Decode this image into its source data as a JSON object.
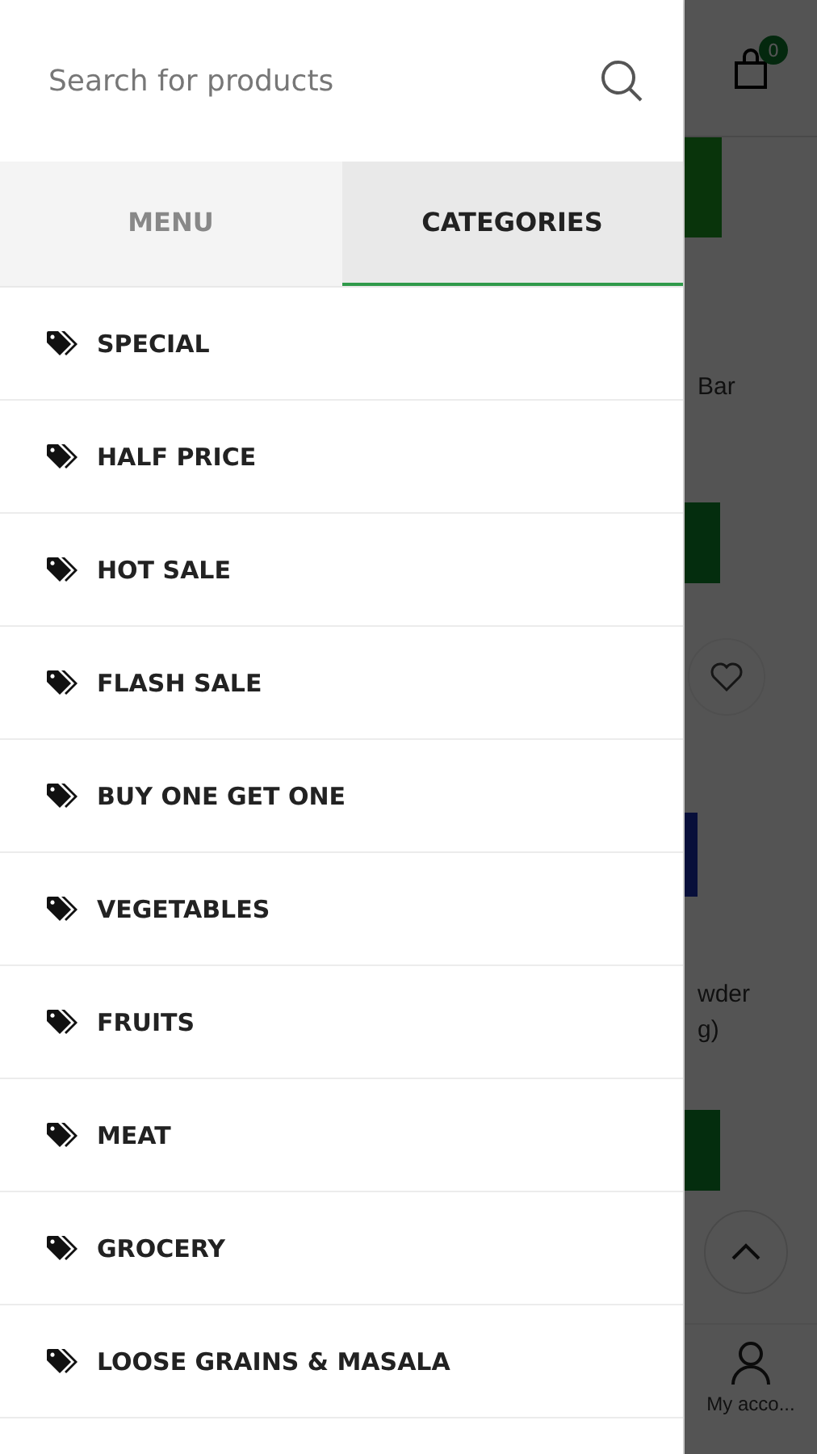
{
  "search": {
    "placeholder": "Search for products"
  },
  "tabs": [
    {
      "label": "MENU",
      "selected": false
    },
    {
      "label": "CATEGORIES",
      "selected": true
    }
  ],
  "categories": [
    {
      "label": "SPECIAL"
    },
    {
      "label": "HALF PRICE"
    },
    {
      "label": "HOT SALE"
    },
    {
      "label": "FLASH SALE"
    },
    {
      "label": "BUY ONE GET ONE"
    },
    {
      "label": "VEGETABLES"
    },
    {
      "label": "FRUITS"
    },
    {
      "label": "MEAT"
    },
    {
      "label": "GROCERY"
    },
    {
      "label": "LOOSE GRAINS & MASALA"
    }
  ],
  "background_page": {
    "cart_count": "0",
    "products": [
      {
        "title_lines": [
          "Bar"
        ]
      },
      {
        "title_lines": [
          "wder",
          "g)"
        ]
      }
    ],
    "account_label": "My acco..."
  }
}
